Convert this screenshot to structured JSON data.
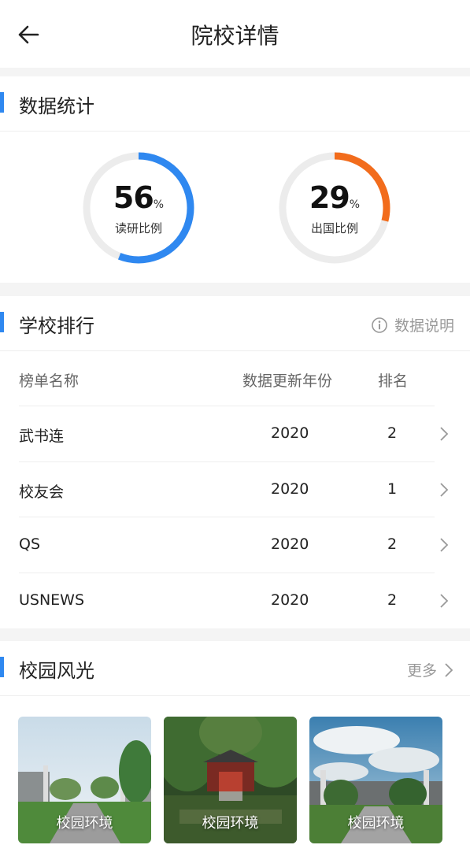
{
  "header": {
    "title": "院校详情"
  },
  "stats": {
    "section_title": "数据统计",
    "items": [
      {
        "value": "56",
        "unit": "%",
        "label": "读研比例",
        "fraction": 0.56,
        "color": "#2f88f0"
      },
      {
        "value": "29",
        "unit": "%",
        "label": "出国比例",
        "fraction": 0.29,
        "color": "#f26c1c"
      }
    ]
  },
  "ranking": {
    "section_title": "学校排行",
    "info_label": "数据说明",
    "columns": [
      "榜单名称",
      "数据更新年份",
      "排名"
    ],
    "rows": [
      {
        "name": "武书连",
        "year": "2020",
        "rank": "2"
      },
      {
        "name": "校友会",
        "year": "2020",
        "rank": "1"
      },
      {
        "name": "QS",
        "year": "2020",
        "rank": "2"
      },
      {
        "name": "USNEWS",
        "year": "2020",
        "rank": "2"
      }
    ]
  },
  "scenery": {
    "section_title": "校园风光",
    "more_label": "更多",
    "photos": [
      {
        "caption": "校园环境"
      },
      {
        "caption": "校园环境"
      },
      {
        "caption": "校园环境"
      }
    ]
  }
}
